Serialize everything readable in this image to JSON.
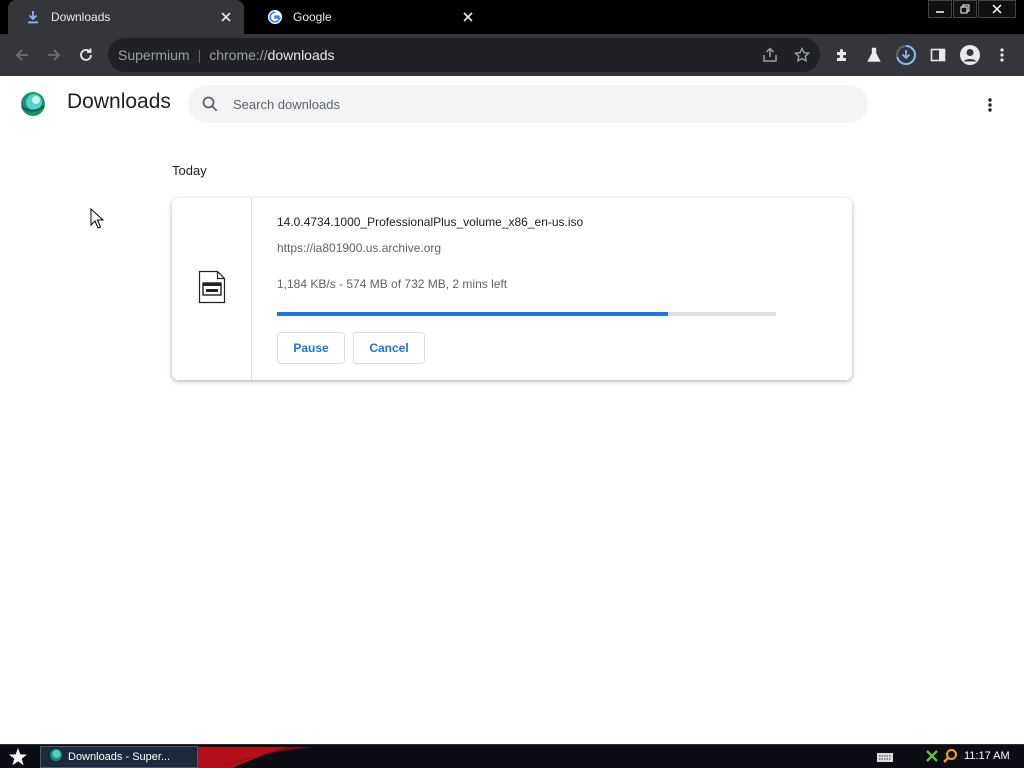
{
  "tabs": [
    {
      "title": "Downloads",
      "icon": "download-icon",
      "active": true
    },
    {
      "title": "Google",
      "icon": "google-icon",
      "active": false
    }
  ],
  "omnibox": {
    "brand": "Supermium",
    "scheme": "chrome://",
    "path": "downloads"
  },
  "header": {
    "title": "Downloads",
    "search_placeholder": "Search downloads"
  },
  "section": {
    "label": "Today"
  },
  "download": {
    "file_name": "14.0.4734.1000_ProfessionalPlus_volume_x86_en-us.iso",
    "url": "https://ia801900.us.archive.org",
    "status": "1,184 KB/s - 574 MB of 732 MB, 2 mins left",
    "progress_fraction": 0.784,
    "pause_label": "Pause",
    "cancel_label": "Cancel"
  },
  "taskbar": {
    "task_label": "Downloads - Super...",
    "clock": "11:17 AM"
  },
  "colors": {
    "accent": "#1a73e8",
    "toolbar": "#35363a",
    "tabstrip": "#000000",
    "omnibox": "#202124"
  }
}
